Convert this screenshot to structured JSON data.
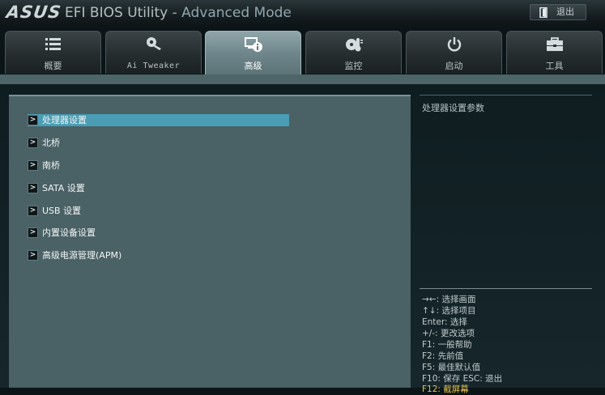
{
  "window": {
    "logo": "ASUS",
    "title_part1": "EFI BIOS Utility",
    "title_separator": " - ",
    "title_part2": "Advanced Mode",
    "exit_label": "退出",
    "exit_icon": "exit-door-icon"
  },
  "tabs": [
    {
      "label": "概要",
      "icon": "list-icon",
      "active": false
    },
    {
      "label": "Ai Tweaker",
      "icon": "tweaker-icon",
      "active": false
    },
    {
      "label": "高级",
      "icon": "advanced-info-icon",
      "active": true
    },
    {
      "label": "监控",
      "icon": "thermometer-fan-icon",
      "active": false
    },
    {
      "label": "启动",
      "icon": "power-icon",
      "active": false
    },
    {
      "label": "工具",
      "icon": "toolbox-icon",
      "active": false
    }
  ],
  "menu": {
    "items": [
      {
        "label": "处理器设置",
        "selected": true
      },
      {
        "label": "北桥",
        "selected": false
      },
      {
        "label": "南桥",
        "selected": false
      },
      {
        "label": "SATA 设置",
        "selected": false
      },
      {
        "label": "USB 设置",
        "selected": false
      },
      {
        "label": "内置设备设置",
        "selected": false
      },
      {
        "label": "高级电源管理(APM)",
        "selected": false
      }
    ]
  },
  "info": {
    "description": "处理器设置参数",
    "help": [
      "→←: 选择画面",
      "↑↓: 选择项目",
      "Enter: 选择",
      "+/-: 更改选项",
      "F1: 一般帮助",
      "F2: 先前值",
      "F5: 最佳默认值",
      "F10: 保存  ESC: 退出",
      "F12: 截屏幕"
    ]
  },
  "colors": {
    "accent_selected": "#4a9db4",
    "panel": "#4a6165",
    "active_tab": "#6f878c",
    "hotkey_text": "#e8c24a"
  }
}
